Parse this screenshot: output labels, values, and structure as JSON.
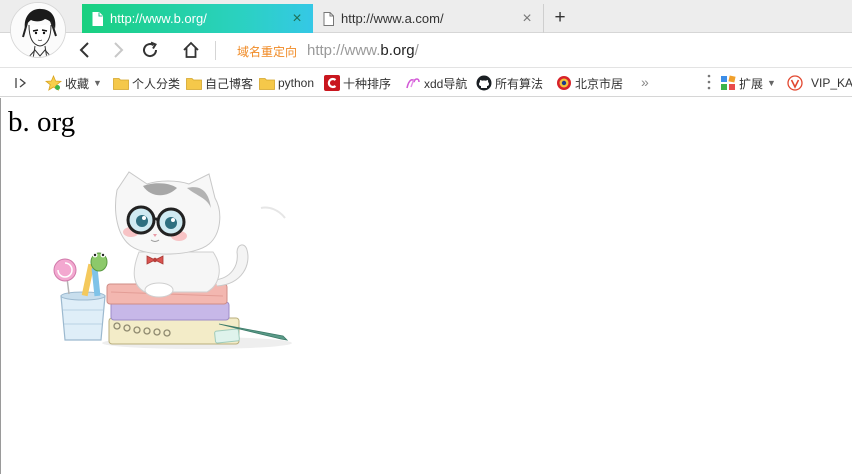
{
  "tabs": [
    {
      "title": "http://www.b.org/",
      "active": true
    },
    {
      "title": "http://www.a.com/",
      "active": false
    }
  ],
  "new_tab_glyph": "+",
  "close_glyph": "×",
  "navbar": {
    "redirect_label": "域名重定向",
    "url_prefix": "http://www.",
    "url_host": "b.org",
    "url_suffix": "/"
  },
  "bookmarks": {
    "toggle_glyph": "|▷",
    "items": [
      {
        "label": "收藏",
        "icon": "star-icon"
      },
      {
        "label": "个人分类",
        "icon": "folder-icon"
      },
      {
        "label": "自己博客",
        "icon": "folder-icon"
      },
      {
        "label": "python",
        "icon": "folder-icon"
      },
      {
        "label": "十种排序",
        "icon": "csdn-icon"
      },
      {
        "label": "xdd导航",
        "icon": "xdd-icon"
      },
      {
        "label": "所有算法",
        "icon": "github-icon"
      },
      {
        "label": "北京市居",
        "icon": "police-badge-icon"
      }
    ],
    "more_glyph": "»",
    "extensions_label": "扩展",
    "vip_label": "VIP_KA"
  },
  "page": {
    "heading": "b. org"
  },
  "colors": {
    "active_tab_start": "#19d07f",
    "active_tab_end": "#35c8e6",
    "redirect_label": "#f08a24",
    "folder": "#f5c84a"
  }
}
